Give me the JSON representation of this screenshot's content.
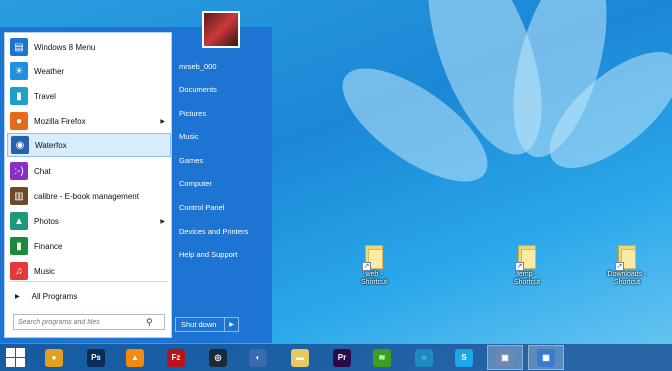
{
  "start_menu": {
    "items": [
      {
        "label": "Windows 8 Menu",
        "icon": "windows8-menu-icon",
        "color": "#1e74d2",
        "glyph": "▤",
        "submenu": false
      },
      {
        "label": "Weather",
        "icon": "weather-icon",
        "color": "#1f8fe0",
        "glyph": "☀",
        "submenu": false
      },
      {
        "label": "Travel",
        "icon": "travel-icon",
        "color": "#1ea0c8",
        "glyph": "▮",
        "submenu": false
      },
      {
        "label": "Mozilla Firefox",
        "icon": "firefox-icon",
        "color": "#e56a1c",
        "glyph": "●",
        "submenu": true
      },
      {
        "label": "Waterfox",
        "icon": "waterfox-icon",
        "color": "#2a5fb0",
        "glyph": "◉",
        "submenu": false
      },
      {
        "label": "Chat",
        "icon": "chat-icon",
        "color": "#8b2fc4",
        "glyph": ":-)",
        "submenu": false
      },
      {
        "label": "calibre - E-book management",
        "icon": "calibre-icon",
        "color": "#6b4a2a",
        "glyph": "▥",
        "submenu": false
      },
      {
        "label": "Photos",
        "icon": "photos-icon",
        "color": "#1a9a7a",
        "glyph": "▲",
        "submenu": true
      },
      {
        "label": "Finance",
        "icon": "finance-icon",
        "color": "#1b8a3a",
        "glyph": "▮",
        "submenu": false
      },
      {
        "label": "Music",
        "icon": "music-icon",
        "color": "#e23a3a",
        "glyph": "♫",
        "submenu": false
      }
    ],
    "selected_index": 4,
    "all_programs_label": "All Programs",
    "search_placeholder": "Search programs and files",
    "right_items": [
      "mrseb_000",
      "Documents",
      "Pictures",
      "Music",
      "Games",
      "Computer",
      "Control Panel",
      "Devices and Printers",
      "Help and Support"
    ],
    "shutdown_label": "Shut down"
  },
  "desktop_icons": [
    {
      "label_line1": "web -",
      "label_line2": "Shortcut"
    },
    {
      "label_line1": "temp -",
      "label_line2": "Shortcut"
    },
    {
      "label_line1": "Downloads -",
      "label_line2": "Shortcut"
    }
  ],
  "taskbar": {
    "items": [
      {
        "name": "chrome",
        "icon": "chrome-icon",
        "color": "#e0a020",
        "glyph": "●"
      },
      {
        "name": "photoshop",
        "icon": "photoshop-icon",
        "color": "#0a2a5a",
        "glyph": "Ps"
      },
      {
        "name": "vlc",
        "icon": "vlc-icon",
        "color": "#f08a10",
        "glyph": "▲"
      },
      {
        "name": "filezilla",
        "icon": "filezilla-icon",
        "color": "#b8141a",
        "glyph": "Fz"
      },
      {
        "name": "steam",
        "icon": "steam-icon",
        "color": "#1a2a3a",
        "glyph": "◎"
      },
      {
        "name": "app",
        "icon": "app-icon",
        "color": "#3a6ab0",
        "glyph": "◐"
      },
      {
        "name": "explorer",
        "icon": "file-explorer-icon",
        "color": "#e8c860",
        "glyph": "▬"
      },
      {
        "name": "premiere",
        "icon": "premiere-icon",
        "color": "#2a0a4a",
        "glyph": "Pr"
      },
      {
        "name": "spotify",
        "icon": "spotify-icon",
        "color": "#3aa020",
        "glyph": "≋"
      },
      {
        "name": "browser",
        "icon": "browser-icon",
        "color": "#1a8ac0",
        "glyph": "○"
      },
      {
        "name": "skype",
        "icon": "skype-icon",
        "color": "#1aa8e8",
        "glyph": "S"
      },
      {
        "name": "remote",
        "icon": "remote-desktop-icon",
        "color": "#6a8ab0",
        "glyph": "▣"
      },
      {
        "name": "control",
        "icon": "control-panel-icon",
        "color": "#3a7ad0",
        "glyph": "▦"
      }
    ]
  }
}
